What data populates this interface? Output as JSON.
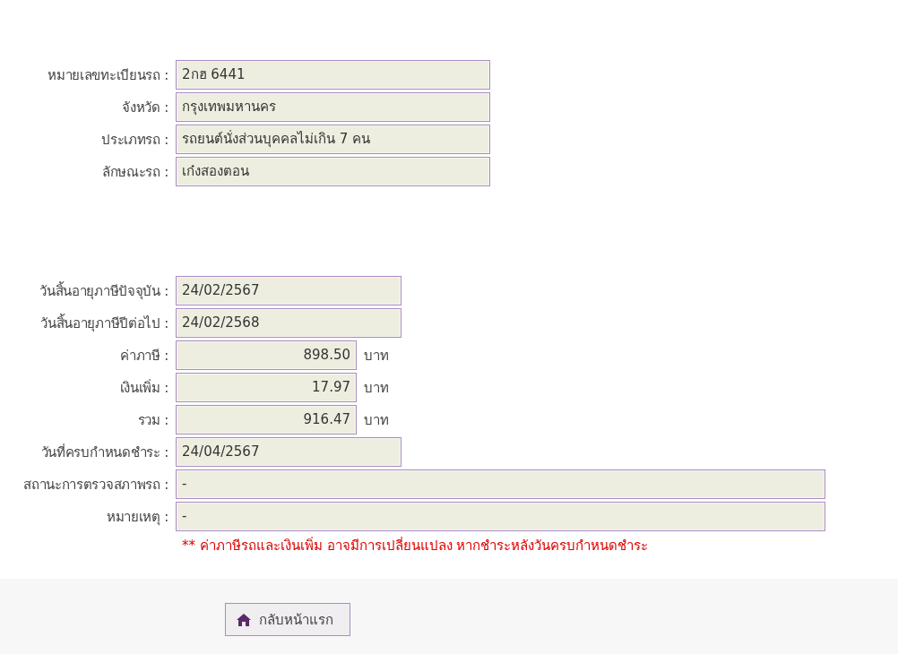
{
  "vehicle_section": [
    {
      "label": "หมายเลขทะเบียนรถ :",
      "value": "2กฮ 6441",
      "kind": "medium"
    },
    {
      "label": "จังหวัด :",
      "value": "กรุงเทพมหานคร",
      "kind": "medium"
    },
    {
      "label": "ประเภทรถ :",
      "value": "รถยนต์นั่งส่วนบุคคลไม่เกิน 7 คน",
      "kind": "medium"
    },
    {
      "label": "ลักษณะรถ :",
      "value": "เก๋งสองตอน",
      "kind": "medium"
    }
  ],
  "tax_section": [
    {
      "label": "วันสิ้นอายุภาษีปัจจุบัน :",
      "value": "24/02/2567",
      "kind": "date"
    },
    {
      "label": "วันสิ้นอายุภาษีปีต่อไป :",
      "value": "24/02/2568",
      "kind": "date"
    },
    {
      "label": "ค่าภาษี :",
      "value": "898.50",
      "kind": "amount",
      "unit": "บาท"
    },
    {
      "label": "เงินเพิ่ม :",
      "value": "17.97",
      "kind": "amount",
      "unit": "บาท"
    },
    {
      "label": "รวม :",
      "value": "916.47",
      "kind": "amount",
      "unit": "บาท"
    },
    {
      "label": "วันที่ครบกำหนดชำระ :",
      "value": "24/04/2567",
      "kind": "date"
    },
    {
      "label": "สถานะการตรวจสภาพรถ :",
      "value": "-",
      "kind": "wide"
    },
    {
      "label": "หมายเหตุ :",
      "value": "-",
      "kind": "wide"
    }
  ],
  "note": "** ค่าภาษีรถและเงินเพิ่ม อาจมีการเปลี่ยนแปลง หากชำระหลังวันครบกำหนดชำระ",
  "home_button": {
    "label": "กลับหน้าแรก"
  }
}
